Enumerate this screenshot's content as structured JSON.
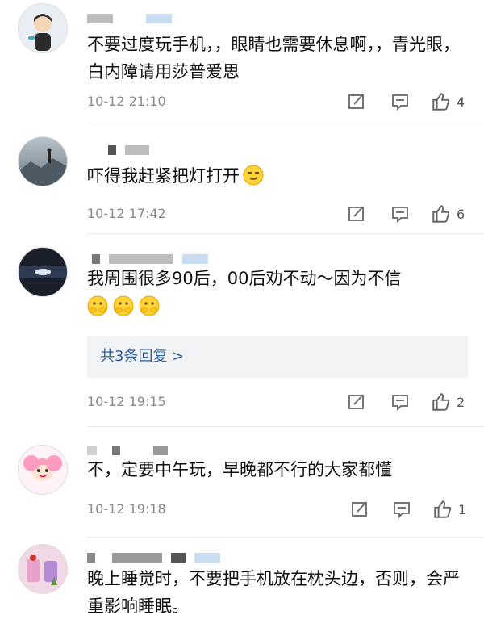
{
  "comments": [
    {
      "text": "不要过度玩手机，，眼睛也需要休息啊，，青光眼，白内障请用莎普爱思",
      "time": "10-12 21:10",
      "likes": "4",
      "avatar": "cartoon-boy-avatar"
    },
    {
      "text": "吓得我赶紧把灯打开",
      "time": "10-12 17:42",
      "likes": "6",
      "avatar": "mountain-photo-avatar",
      "emoji": "smirk-emoji"
    },
    {
      "text": "我周围很多90后，00后劝不动～因为不信",
      "time": "10-12 19:15",
      "likes": "2",
      "avatar": "dark-sky-photo-avatar",
      "emoji": "covering-mouth-emoji",
      "replies_label": "共3条回复 >"
    },
    {
      "text": "不，定要中午玩，早晚都不行的大家都懂",
      "time": "10-12 19:18",
      "likes": "1",
      "avatar": "pink-cartoon-girl-avatar"
    },
    {
      "text": "晚上睡觉时，不要把手机放在枕头边，否则，会严重影响睡眠。",
      "avatar": "drinks-photo-avatar"
    }
  ],
  "colors": {
    "link": "#2d5d98",
    "meta": "#8a8a8a",
    "reply_bg": "#f2f3f5"
  }
}
